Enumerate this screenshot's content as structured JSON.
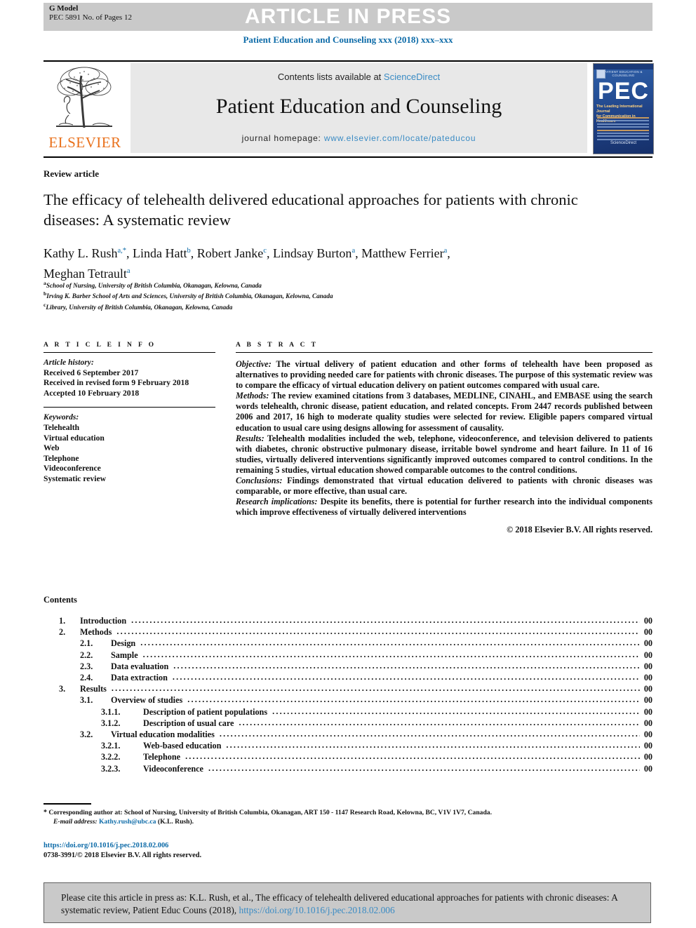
{
  "header": {
    "g_model_line1": "G Model",
    "g_model_line2": "PEC 5891 No. of Pages 12",
    "banner_text": "ARTICLE IN PRESS",
    "journal_ref": "Patient Education and Counseling xxx (2018) xxx–xxx"
  },
  "masthead": {
    "contents_prefix": "Contents lists available at ",
    "sciencedirect": "ScienceDirect",
    "journal_title": "Patient Education and Counseling",
    "homepage_prefix": "journal homepage: ",
    "homepage_url": "www.elsevier.com/locate/pateducou",
    "publisher": "ELSEVIER",
    "cover": {
      "header": "PATIENT EDUCATION & COUNSELING",
      "logo_text": "PEC",
      "subtitle_line1": "The Leading International Journal",
      "subtitle_line2": "for Communication in Healthcare",
      "footer": "ScienceDirect"
    }
  },
  "article": {
    "kind": "Review article",
    "title": "The efficacy of telehealth delivered educational approaches for patients with chronic diseases: A systematic review",
    "authors": [
      {
        "name": "Kathy L. Rush",
        "sup": "a,*"
      },
      {
        "name": "Linda Hatt",
        "sup": "b"
      },
      {
        "name": "Robert Janke",
        "sup": "c"
      },
      {
        "name": "Lindsay Burton",
        "sup": "a"
      },
      {
        "name": "Matthew Ferrier",
        "sup": "a"
      },
      {
        "name": "Meghan Tetrault",
        "sup": "a"
      }
    ],
    "affiliations": [
      {
        "mark": "a",
        "text": "School of Nursing, University of British Columbia, Okanagan, Kelowna, Canada"
      },
      {
        "mark": "b",
        "text": "Irving K. Barber School of Arts and Sciences, University of British Columbia, Okanagan, Kelowna, Canada"
      },
      {
        "mark": "c",
        "text": "Library, University of British Columbia, Okanagan, Kelowna, Canada"
      }
    ]
  },
  "article_info": {
    "heading": "A R T I C L E  I N F O",
    "history_label": "Article history:",
    "history": [
      "Received 6 September 2017",
      "Received in revised form 9 February 2018",
      "Accepted 10 February 2018"
    ],
    "keywords_label": "Keywords:",
    "keywords": [
      "Telehealth",
      "Virtual education",
      "Web",
      "Telephone",
      "Videoconference",
      "Systematic review"
    ]
  },
  "abstract": {
    "heading": "A B S T R A C T",
    "sections": [
      {
        "lead": "Objective:",
        "text": " The virtual delivery of patient education and other forms of telehealth have been proposed as alternatives to providing needed care for patients with chronic diseases. The purpose of this systematic review was to compare the efficacy of virtual education delivery on patient outcomes compared with usual care."
      },
      {
        "lead": "Methods:",
        "text": " The review examined citations from 3 databases, MEDLINE, CINAHL, and EMBASE using the search words telehealth, chronic disease, patient education, and related concepts. From 2447 records published between 2006 and 2017, 16 high to moderate quality studies were selected for review. Eligible papers compared virtual education to usual care using designs allowing for assessment of causality."
      },
      {
        "lead": "Results:",
        "text": " Telehealth modalities included the web, telephone, videoconference, and television delivered to patients with diabetes, chronic obstructive pulmonary disease, irritable bowel syndrome and heart failure. In 11 of 16 studies, virtually delivered interventions significantly improved outcomes compared to control conditions. In the remaining 5 studies, virtual education showed comparable outcomes to the control conditions."
      },
      {
        "lead": "Conclusions:",
        "text": " Findings demonstrated that virtual education delivered to patients with chronic diseases was comparable, or more effective, than usual care."
      },
      {
        "lead": "Research implications:",
        "text": " Despite its benefits, there is potential for further research into the individual components which improve effectiveness of virtually delivered interventions"
      }
    ],
    "copyright": "© 2018 Elsevier B.V. All rights reserved."
  },
  "contents": {
    "heading": "Contents",
    "items": [
      {
        "level": 1,
        "num": "1.",
        "label": "Introduction",
        "page": "00"
      },
      {
        "level": 1,
        "num": "2.",
        "label": "Methods",
        "page": "00"
      },
      {
        "level": 2,
        "num": "2.1.",
        "label": "Design",
        "page": "00"
      },
      {
        "level": 2,
        "num": "2.2.",
        "label": "Sample",
        "page": "00"
      },
      {
        "level": 2,
        "num": "2.3.",
        "label": "Data evaluation",
        "page": "00"
      },
      {
        "level": 2,
        "num": "2.4.",
        "label": "Data extraction",
        "page": "00"
      },
      {
        "level": 1,
        "num": "3.",
        "label": "Results",
        "page": "00"
      },
      {
        "level": 2,
        "num": "3.1.",
        "label": "Overview of studies",
        "page": "00"
      },
      {
        "level": 3,
        "num": "3.1.1.",
        "label": "Description of patient populations",
        "page": "00"
      },
      {
        "level": 3,
        "num": "3.1.2.",
        "label": "Description of usual care",
        "page": "00"
      },
      {
        "level": 2,
        "num": "3.2.",
        "label": "Virtual education modalities",
        "page": "00"
      },
      {
        "level": 3,
        "num": "3.2.1.",
        "label": "Web-based education",
        "page": "00"
      },
      {
        "level": 3,
        "num": "3.2.2.",
        "label": "Telephone",
        "page": "00"
      },
      {
        "level": 3,
        "num": "3.2.3.",
        "label": "Videoconference",
        "page": "00"
      }
    ]
  },
  "footnote": {
    "star": "*",
    "corresponding": "Corresponding author at: School of Nursing, University of British Columbia, Okanagan, ART 150 - 1147 Research Road, Kelowna, BC, V1V 1V7, Canada.",
    "email_label": "E-mail address:",
    "email": "Kathy.rush@ubc.ca",
    "email_suffix": "(K.L. Rush)."
  },
  "doi_block": {
    "doi": "https://doi.org/10.1016/j.pec.2018.02.006",
    "issn": "0738-3991/© 2018 Elsevier B.V. All rights reserved."
  },
  "citation_box": {
    "text_before": "Please cite this article in press as: K.L. Rush, et al., The efficacy of telehealth delivered educational approaches for patients with chronic diseases: A systematic review, Patient Educ Couns (2018), ",
    "doi": "https://doi.org/10.1016/j.pec.2018.02.006"
  },
  "colors": {
    "link_dark": "#0d6ba8",
    "link_light": "#3a8bc4",
    "banner_gray": "#c9c9c9",
    "masthead_gray": "#e8e8e8",
    "elsevier_orange": "#E9711C"
  }
}
